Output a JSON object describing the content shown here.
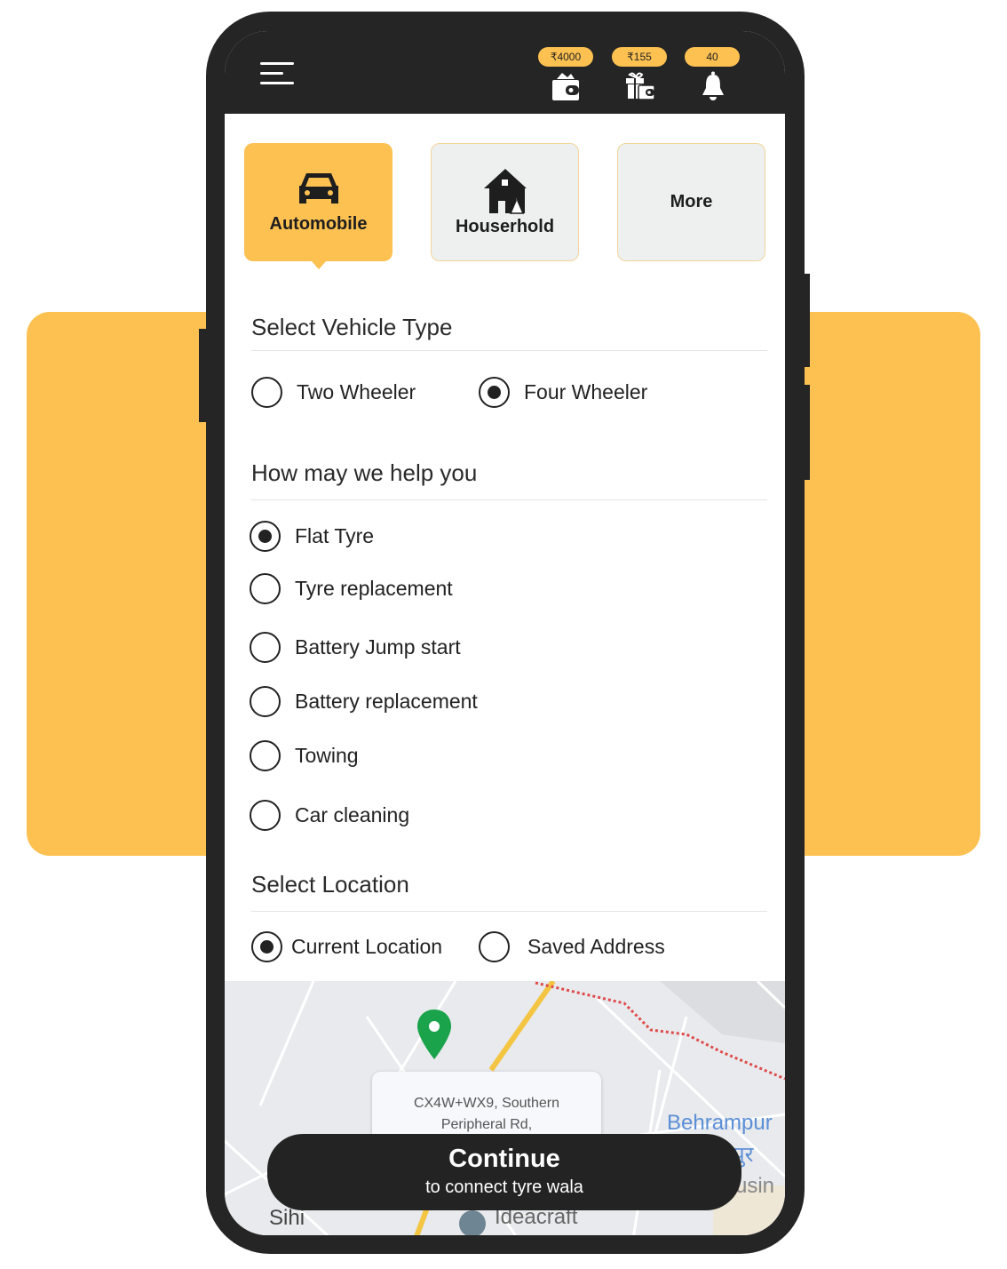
{
  "header": {
    "wallet_balance": "₹4000",
    "gift_balance": "₹155",
    "notification_count": "40",
    "icons": [
      "menu-icon",
      "wallet-icon",
      "gift-wallet-icon",
      "bell-icon"
    ]
  },
  "categories": [
    {
      "label": "Automobile",
      "icon": "car-icon",
      "active": true
    },
    {
      "label": "Houserhold",
      "icon": "house-broom-icon",
      "active": false
    },
    {
      "label": "More",
      "active": false
    }
  ],
  "vehicle": {
    "title": "Select Vehicle Type",
    "options": [
      {
        "label": "Two Wheeler",
        "selected": false
      },
      {
        "label": "Four Wheeler",
        "selected": true
      }
    ]
  },
  "help": {
    "title": "How may we help you",
    "options": [
      {
        "label": "Flat Tyre",
        "selected": true
      },
      {
        "label": "Tyre replacement",
        "selected": false
      },
      {
        "label": "Battery Jump start",
        "selected": false
      },
      {
        "label": "Battery replacement",
        "selected": false
      },
      {
        "label": "Towing",
        "selected": false
      },
      {
        "label": "Car cleaning",
        "selected": false
      }
    ]
  },
  "location": {
    "title": "Select Location",
    "options": [
      {
        "label": "Current Location",
        "selected": true
      },
      {
        "label": "Saved Address",
        "selected": false
      }
    ]
  },
  "map": {
    "address_line1": "CX4W+WX9, Southern",
    "address_line2": "Peripheral Rd,",
    "labels": {
      "behrampur": "Behrampur",
      "behrampur_hindi": "पुर",
      "housing": "usin",
      "sihi": "Sihi",
      "ideacraft": "Ideacraft"
    },
    "pin_color": "#1aa34a"
  },
  "continue": {
    "title": "Continue",
    "subtitle": "to connect tyre wala"
  },
  "colors": {
    "accent": "#FDC151",
    "dark": "#252525"
  }
}
